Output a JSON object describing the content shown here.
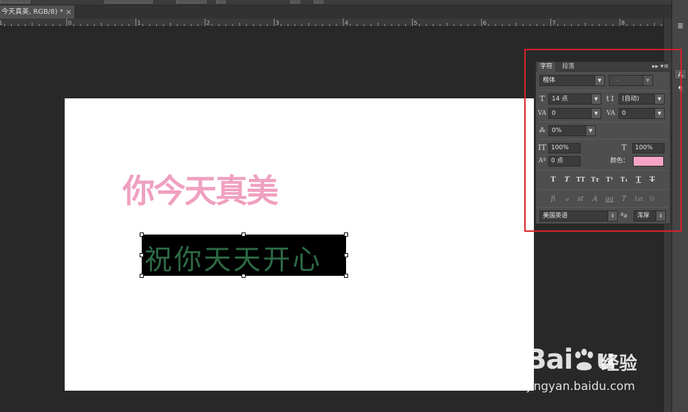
{
  "document": {
    "tab_title": "今天真美, RGB/8) *",
    "close_glyph": "×"
  },
  "ruler": {
    "labels": [
      "1",
      "0",
      "1",
      "2",
      "3",
      "4",
      "5",
      "6",
      "7",
      "8"
    ]
  },
  "canvas": {
    "pink_text": "你今天真美",
    "selected_text": "祝你天天开心",
    "pink_color": "#f0a0c0",
    "selected_text_color": "#2d6a44"
  },
  "character_panel": {
    "tabs": [
      {
        "label": "字符",
        "active": true
      },
      {
        "label": "段落",
        "active": false
      }
    ],
    "menu_glyph": "▸▸  ▾≡",
    "font_family": "楷体",
    "font_style": "-",
    "font_size": "14 点",
    "leading": "(自动)",
    "kerning": "0",
    "tracking": "0",
    "tsume": "0%",
    "vertical_scale": "100%",
    "horizontal_scale": "100%",
    "baseline_shift": "0 点",
    "color_label": "颜色：",
    "color_value": "#f5a3c6",
    "style_buttons": [
      "T",
      "T",
      "TT",
      "Tт",
      "T¹",
      "T₁",
      "T",
      "T"
    ],
    "opentype_buttons": [
      "fi",
      "ℴ",
      "st",
      "A",
      "aa",
      "T",
      "1st",
      "½"
    ],
    "language": "美国英语",
    "aa_label": "ªa",
    "antialias": "浑厚"
  },
  "dock": {
    "buttons": [
      "≣",
      "A",
      "¶"
    ]
  },
  "watermark": {
    "logo_prefix": "Bai",
    "logo_suffix": "u",
    "logo_text": "经验",
    "url": "jingyan.baidu.com"
  },
  "highlight_color": "#d8222a"
}
